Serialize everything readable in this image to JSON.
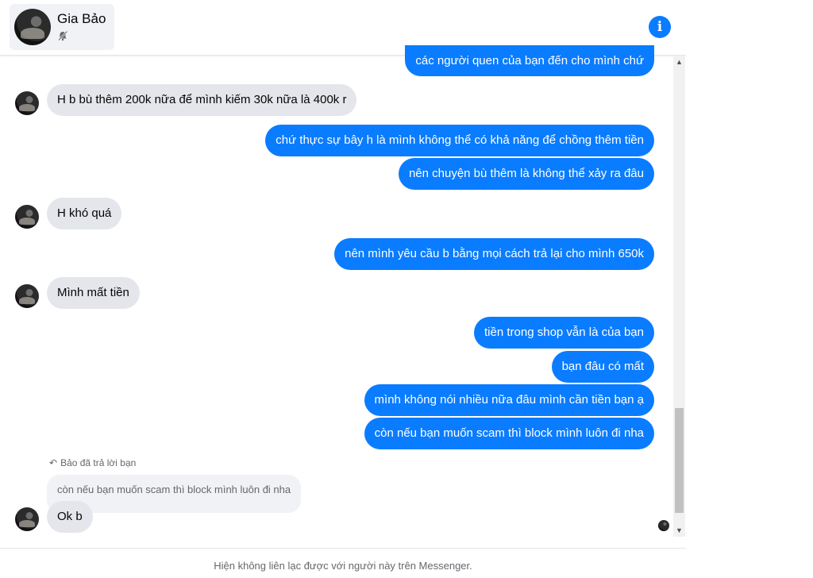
{
  "header": {
    "contact_name": "Gia Bảo",
    "status_icon": "muted-bell-icon",
    "info_icon": "info-icon",
    "accent": "#0a7cff"
  },
  "messages": [
    {
      "from": "me",
      "text": "các người quen của bạn đến cho mình chứ"
    },
    {
      "from": "them",
      "text": "H b bù thêm 200k nữa để mình kiếm 30k nữa là 400k r"
    },
    {
      "from": "me",
      "text": "chứ thực sự bây h là mình không thể có khả năng để chồng thêm tiền"
    },
    {
      "from": "me",
      "text": "nên chuyện bù thêm là không thể xảy ra đâu"
    },
    {
      "from": "them",
      "text": "H khó quá"
    },
    {
      "from": "me",
      "text": "nên mình yêu cầu b  bằng mọi cách trả lại cho mình 650k"
    },
    {
      "from": "them",
      "text": "Mình mất tiền"
    },
    {
      "from": "me",
      "text": "tiền trong shop vẫn là của bạn"
    },
    {
      "from": "me",
      "text": "bạn đâu có mất"
    },
    {
      "from": "me",
      "text": "mình không nói nhiều nữa đâu mình cần tiền bạn ạ"
    },
    {
      "from": "me",
      "text": "còn nếu bạn muốn scam thì block mình luôn đi nha"
    }
  ],
  "reply": {
    "caption": "Bảo đã trả lời bạn",
    "quoted_text": "còn nếu bạn muốn scam thì block mình luôn đi nha",
    "text": "Ok b"
  },
  "footer": {
    "notice": "Hiện không liên lạc được với người này trên Messenger."
  }
}
